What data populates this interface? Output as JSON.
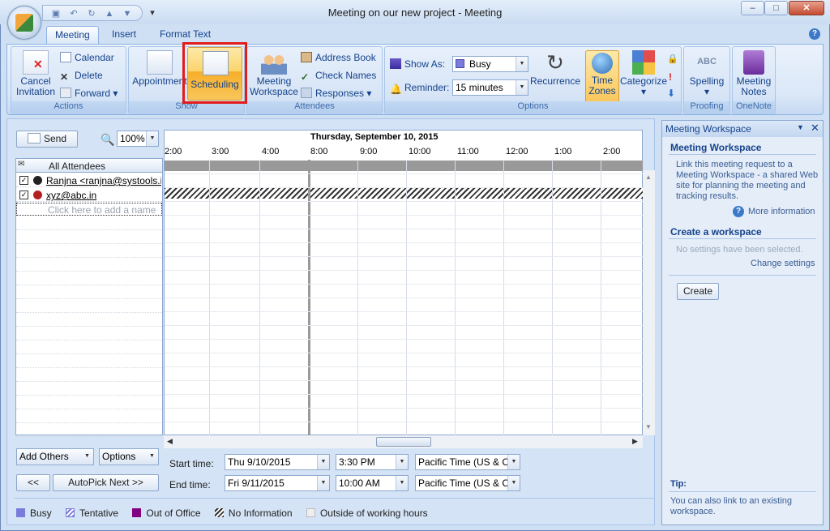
{
  "window": {
    "title": "Meeting on our new project - Meeting",
    "minimize": "–",
    "maximize": "□",
    "close": "✕"
  },
  "ribbon_tabs": [
    "Meeting",
    "Insert",
    "Format Text"
  ],
  "groups": {
    "actions": {
      "label": "Actions",
      "cancel": "Cancel",
      "cancel2": "Invitation",
      "calendar": "Calendar",
      "delete": "Delete",
      "forward": "Forward"
    },
    "show": {
      "label": "Show",
      "appointment": "Appointment",
      "scheduling": "Scheduling"
    },
    "attendees": {
      "label": "Attendees",
      "workspace1": "Meeting",
      "workspace2": "Workspace",
      "address_book": "Address Book",
      "check_names": "Check Names",
      "responses": "Responses"
    },
    "options": {
      "label": "Options",
      "show_as_label": "Show As:",
      "show_as": "Busy",
      "reminder_label": "Reminder:",
      "reminder": "15 minutes",
      "recurrence": "Recurrence",
      "time1": "Time",
      "time2": "Zones",
      "categorize": "Categorize"
    },
    "proofing": {
      "label": "Proofing",
      "spelling": "Spelling"
    },
    "onenote": {
      "label": "OneNote",
      "notes1": "Meeting",
      "notes2": "Notes"
    }
  },
  "scheduler": {
    "send": "Send",
    "zoom": "100%",
    "date_header": "Thursday, September 10, 2015",
    "times": [
      "2:00",
      "3:00",
      "4:00",
      "8:00",
      "9:00",
      "10:00",
      "11:00",
      "12:00",
      "1:00",
      "2:00"
    ],
    "all_attendees": "All Attendees",
    "attendees": [
      {
        "name": "Ranjna <ranjna@systools.in>"
      },
      {
        "name": "xyz@abc.in"
      }
    ],
    "add_placeholder": "Click here to add a name",
    "add_others": "Add Others",
    "options": "Options",
    "prev": "<<",
    "autopick": "AutoPick Next >>",
    "start_label": "Start time:",
    "start_date": "Thu 9/10/2015",
    "start_time": "3:30 PM",
    "start_tz": "Pacific Time (US & Ca",
    "end_label": "End time:",
    "end_date": "Fri 9/11/2015",
    "end_time": "10:00 AM",
    "end_tz": "Pacific Time (US & Ca"
  },
  "legend": {
    "busy": "Busy",
    "tentative": "Tentative",
    "ooo": "Out of Office",
    "noinfo": "No Information",
    "outside": "Outside of working hours"
  },
  "pane": {
    "title": "Meeting Workspace",
    "sec1": "Meeting Workspace",
    "desc": "Link this meeting request to a Meeting Workspace - a shared Web site for planning the meeting and tracking results.",
    "more": "More information",
    "sec2": "Create a workspace",
    "nosettings": "No settings have been selected.",
    "change": "Change settings",
    "create": "Create",
    "tip_label": "Tip:",
    "tip": "You can also link to an existing workspace."
  }
}
